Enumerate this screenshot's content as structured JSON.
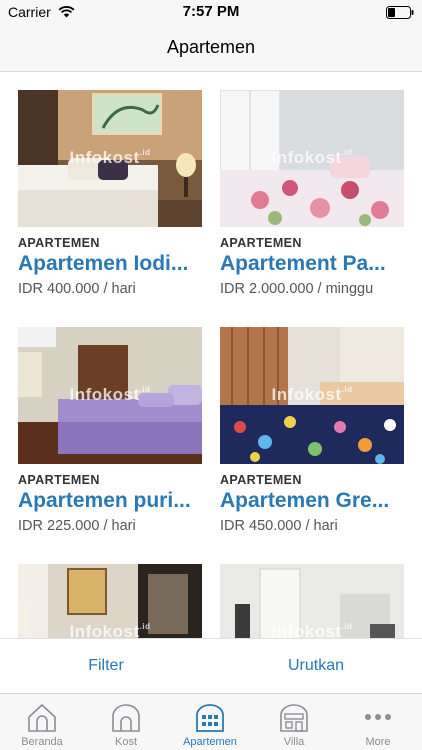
{
  "status_bar": {
    "carrier": "Carrier",
    "time": "7:57 PM"
  },
  "nav": {
    "title": "Apartemen"
  },
  "watermark": {
    "text": "Infokost",
    "suffix": ".id"
  },
  "listings": [
    {
      "category": "APARTEMEN",
      "title": "Apartemen Iodi...",
      "price": "IDR 400.000 / hari"
    },
    {
      "category": "APARTEMEN",
      "title": "Apartement Pa...",
      "price": "IDR 2.000.000 / minggu"
    },
    {
      "category": "APARTEMEN",
      "title": "Apartemen puri...",
      "price": "IDR 225.000 / hari"
    },
    {
      "category": "APARTEMEN",
      "title": "Apartemen Gre...",
      "price": "IDR 450.000 / hari"
    }
  ],
  "actions": {
    "filter": "Filter",
    "sort": "Urutkan"
  },
  "tabs": [
    {
      "label": "Beranda",
      "icon": "house-icon",
      "active": false
    },
    {
      "label": "Kost",
      "icon": "kost-house-icon",
      "active": false
    },
    {
      "label": "Apartemen",
      "icon": "apartment-building-icon",
      "active": true
    },
    {
      "label": "Villa",
      "icon": "villa-icon",
      "active": false
    },
    {
      "label": "More",
      "icon": "more-dots-icon",
      "active": false
    }
  ],
  "colors": {
    "accent": "#2a79b5",
    "inactive_tab": "#8e8e93"
  }
}
